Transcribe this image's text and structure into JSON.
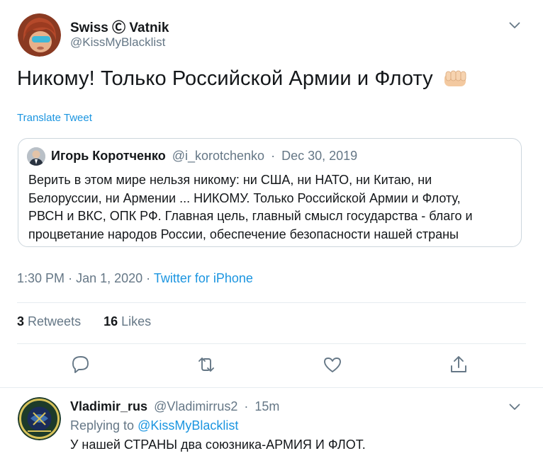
{
  "tweet": {
    "author_name": "Swiss Ⓒ Vatnik",
    "author_handle": "@KissMyBlacklist",
    "text": "Никому! Только Российской Армии и Флоту",
    "translate_label": "Translate Tweet",
    "time": "1:30 PM",
    "date": "Jan 1, 2020",
    "source": "Twitter for iPhone",
    "retweets_count": "3",
    "retweets_label": "Retweets",
    "likes_count": "16",
    "likes_label": "Likes"
  },
  "quote": {
    "author_name": "Игорь Коротченко",
    "author_handle": "@i_korotchenko",
    "date": "Dec 30, 2019",
    "lines": [
      "Верить в этом мире нельзя никому: ни США, ни НАТО, ни Китаю, ни",
      "Белоруссии, ни Армении ... НИКОМУ. Только Российской Армии и Флоту,",
      "РВСН и ВКС, ОПК РФ. Главная цель, главный смысл государства - благо и",
      "процветание народов России, обеспечение безопасности нашей страны"
    ]
  },
  "reply": {
    "author_name": "Vladimir_rus",
    "author_handle": "@Vladimirrus2",
    "time_ago": "15m",
    "replying_to_label": "Replying to",
    "replying_to_handle": "@KissMyBlacklist",
    "text": "У нашей СТРАНЫ два союзника-АРМИЯ И ФЛОТ."
  },
  "icons": {
    "reply": "reply-icon",
    "retweet": "retweet-icon",
    "like": "heart-icon",
    "share": "share-icon",
    "more": "chevron-down-icon"
  },
  "colors": {
    "link": "#1b95e0",
    "secondary_text": "#657786",
    "border": "#e6ecf0"
  }
}
